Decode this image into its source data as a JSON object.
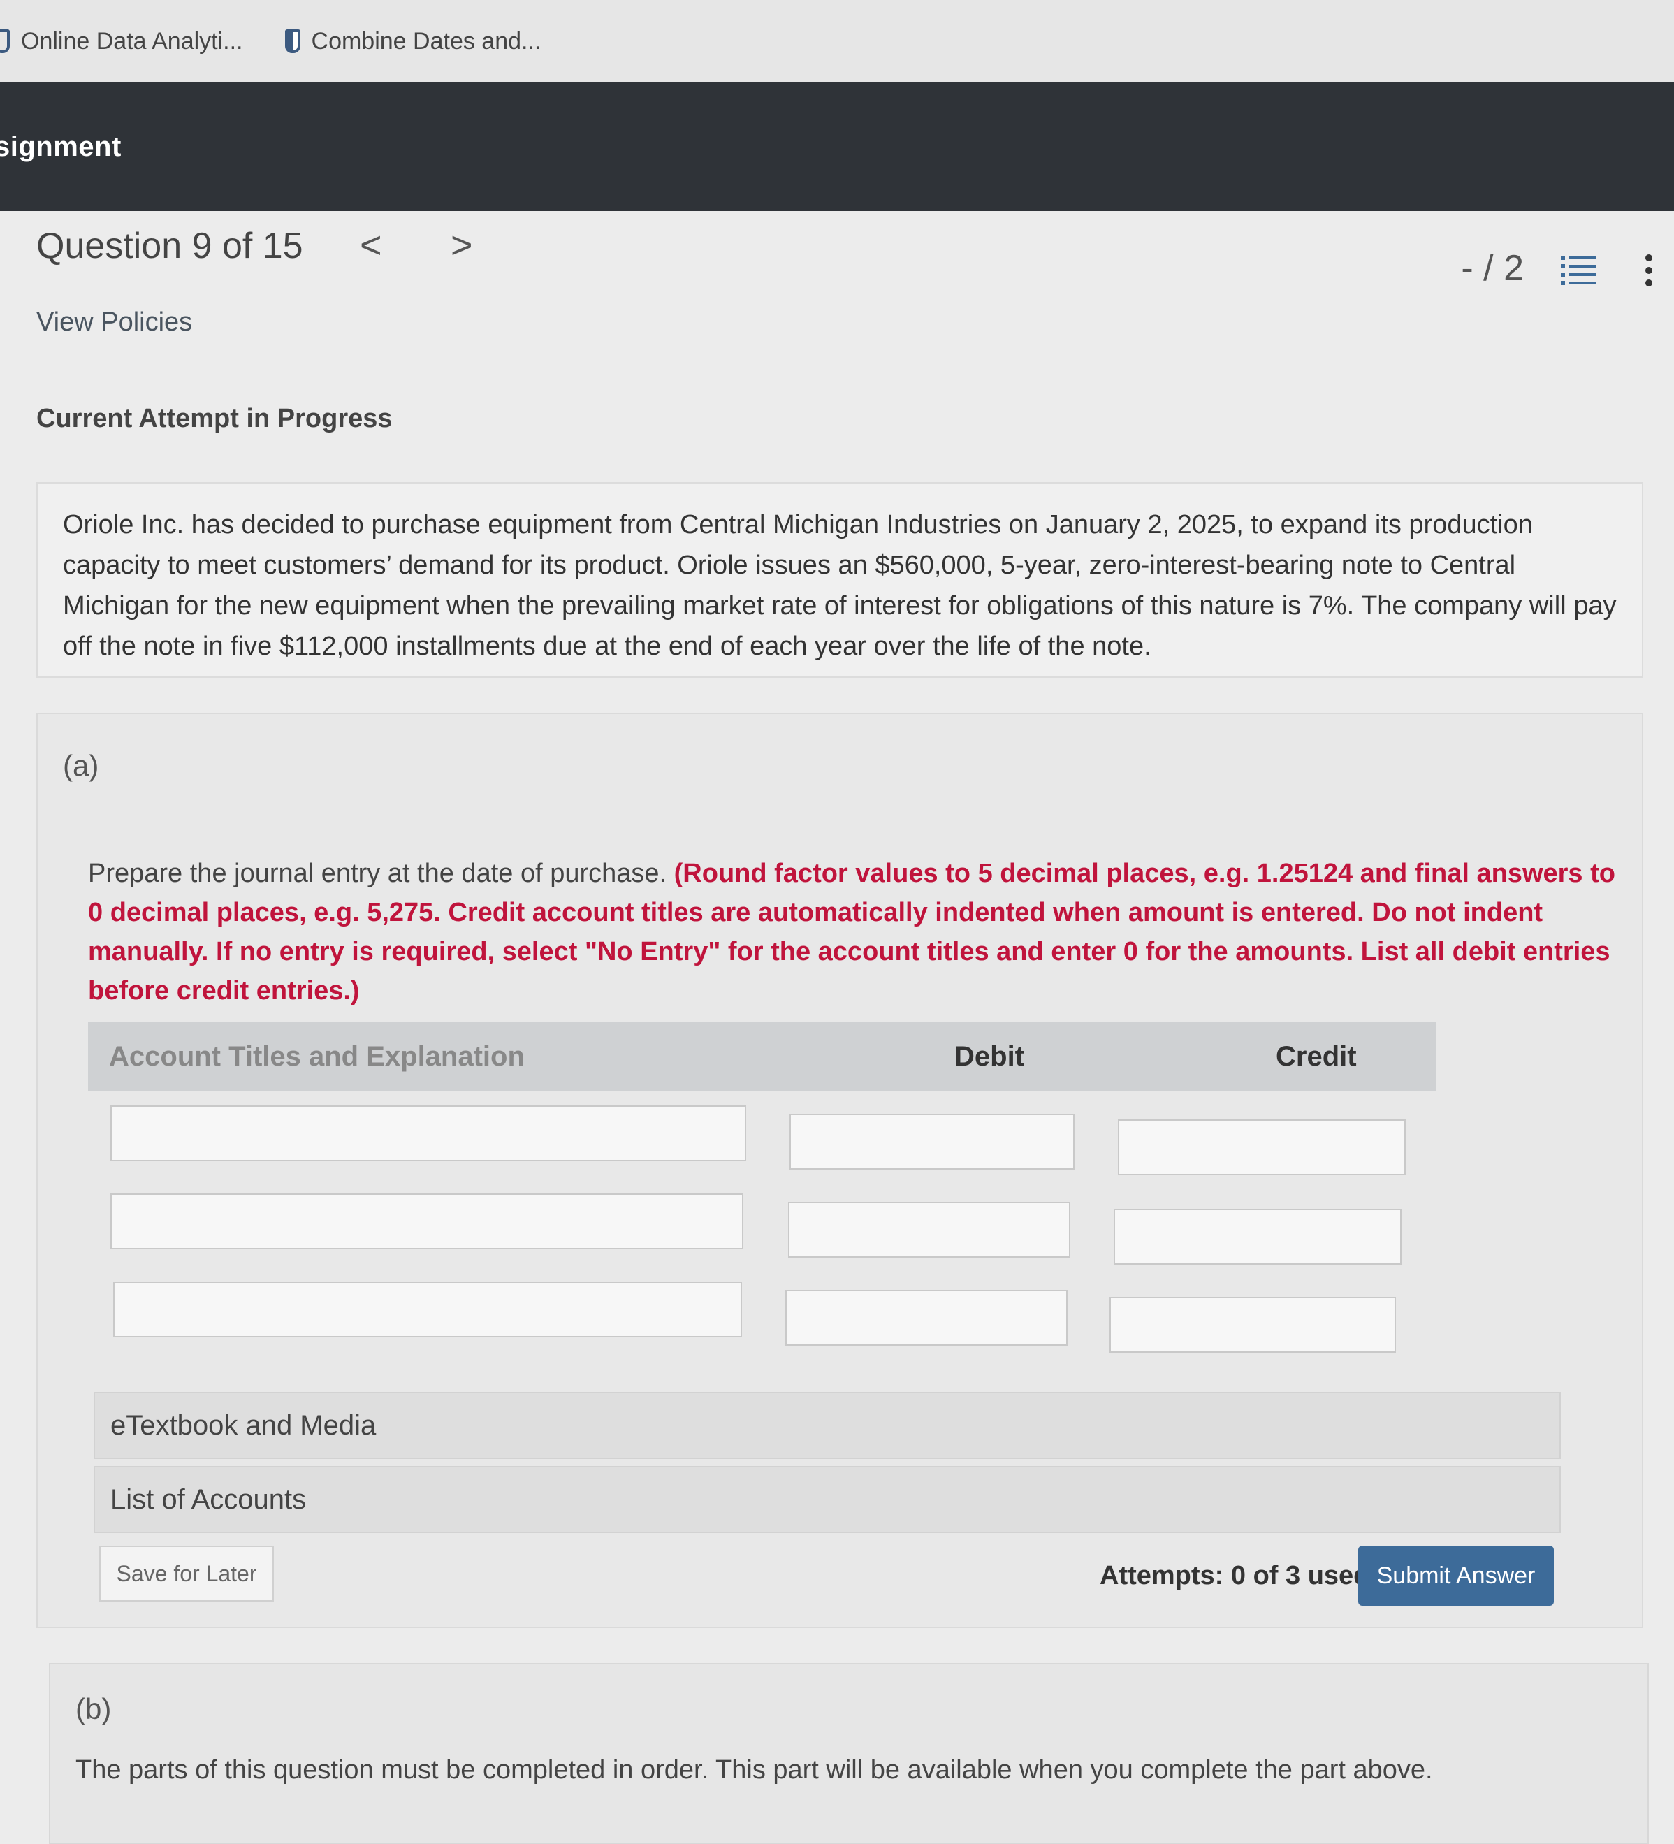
{
  "bookmarks": [
    {
      "label": "Online Data Analyti..."
    },
    {
      "label": "Combine Dates and..."
    }
  ],
  "header": {
    "title": "signment"
  },
  "question": {
    "title": "Question 9 of 15",
    "prev": "<",
    "next": ">",
    "score": "- / 2",
    "view_policies": "View Policies",
    "attempt_status": "Current Attempt in Progress"
  },
  "problem_text": "Oriole Inc. has decided to purchase equipment from Central Michigan Industries on January 2, 2025, to expand its production capacity to meet customers’ demand for its product. Oriole issues an $560,000, 5-year, zero-interest-bearing note to Central Michigan for the new equipment when the prevailing market rate of interest for obligations of this nature is 7%. The company will pay off the note in five $112,000 installments due at the end of each year over the life of the note.",
  "part_a": {
    "label": "(a)",
    "instruction": "Prepare the journal entry at the date of purchase.",
    "instruction_red": "(Round factor values to 5 decimal places, e.g. 1.25124 and final answers to 0 decimal places, e.g. 5,275. Credit account titles are automatically indented when amount is entered. Do not indent manually. If no entry is required, select \"No Entry\" for the account titles and enter 0 for the amounts. List all debit entries before credit entries.)",
    "table": {
      "col_account": "Account Titles and Explanation",
      "col_debit": "Debit",
      "col_credit": "Credit",
      "rows": [
        {
          "account": "",
          "debit": "",
          "credit": ""
        },
        {
          "account": "",
          "debit": "",
          "credit": ""
        },
        {
          "account": "",
          "debit": "",
          "credit": ""
        }
      ]
    },
    "etextbook": "eTextbook and Media",
    "list_accounts": "List of Accounts",
    "save_later": "Save for Later",
    "attempts": "Attempts: 0 of 3 used",
    "submit": "Submit Answer"
  },
  "part_b": {
    "label": "(b)",
    "message": "The parts of this question must be completed in order. This part will be available when you complete the part above."
  }
}
